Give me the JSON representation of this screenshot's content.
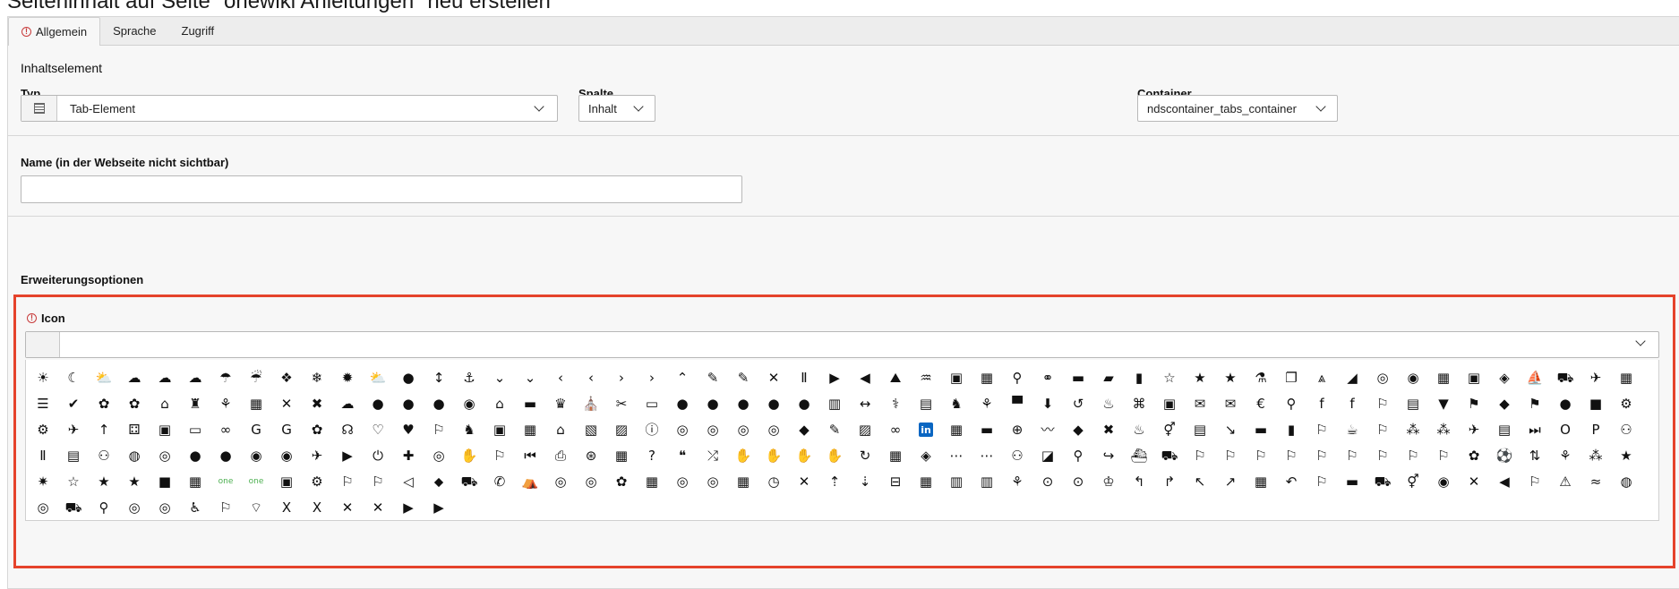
{
  "page": {
    "title": "Seiteninhalt auf Seite \"onewiki Anleitungen\" neu erstellen"
  },
  "tabs": [
    {
      "label": "Allgemein",
      "active": true,
      "has_warning": true
    },
    {
      "label": "Sprache"
    },
    {
      "label": "Zugriff"
    }
  ],
  "section_general": {
    "title": "Inhaltselement",
    "typ": {
      "label": "Typ",
      "value": "Tab-Element"
    },
    "spalte": {
      "label": "Spalte",
      "value": "Inhalt"
    },
    "container": {
      "label": "Container",
      "value": "ndscontainer_tabs_container"
    }
  },
  "name_field": {
    "label": "Name (in der Webseite nicht sichtbar)",
    "value": ""
  },
  "extensions": {
    "title": "Erweiterungsoptionen"
  },
  "icon_field": {
    "label": "Icon",
    "has_warning": true,
    "selected": "",
    "colors": {
      "highlight_border": "#e5432b",
      "warning": "#c83c3c"
    },
    "icons": [
      "☀",
      "☾",
      "⛅",
      "☁",
      "☁",
      "☁",
      "☂",
      "☔",
      "❖",
      "❄",
      "✹",
      "⛅",
      "●",
      "↕",
      "⚓",
      "⌄",
      "⌄",
      "‹",
      "‹",
      "›",
      "›",
      "⌃",
      "✎",
      "✎",
      "✕",
      "Ⅱ",
      "▶",
      "◀",
      "⛰",
      "♒",
      "▣",
      "▦",
      "⚲",
      "⚭",
      "▬",
      "▰",
      "▮",
      "☆",
      "★",
      "★",
      "⚗",
      "❐",
      "⩓",
      "◢",
      "◎",
      "◉",
      "▦",
      "▣",
      "◈",
      "⛵",
      "⛟",
      "✈",
      "▦",
      "☰",
      "✔",
      "✿",
      "✿",
      "⌂",
      "♜",
      "⚘",
      "▦",
      "✕",
      "✖",
      "☁",
      "●",
      "●",
      "●",
      "◉",
      "⌂",
      "▬",
      "♛",
      "⛪",
      "✂",
      "▭",
      "●",
      "●",
      "●",
      "●",
      "●",
      "▥",
      "↔",
      "⚕",
      "▤",
      "♞",
      "⚘",
      "▀",
      "⬇",
      "↺",
      "♨",
      "⌘",
      "▣",
      "✉",
      "✉",
      "€",
      "⚲",
      "f",
      "f",
      "⚐",
      "▤",
      "▼",
      "⚑",
      "◆",
      "⚑",
      "●",
      "■",
      "⚙",
      "⚙",
      "✈",
      "↑",
      "⚃",
      "▣",
      "▭",
      "∞",
      "G",
      "G",
      "✿",
      "☊",
      "♡",
      "♥",
      "⚐",
      "♞",
      "▣",
      "▦",
      "⌂",
      "▧",
      "▨",
      "ⓘ",
      "◎",
      "◎",
      "◎",
      "◎",
      "◆",
      "✎",
      "▨",
      "∞",
      "in",
      "▦",
      "▬",
      "⊕",
      "〰",
      "◆",
      "✖",
      "♨",
      "⚥",
      "▤",
      "↘",
      "▬",
      "▮",
      "⚐",
      "☕",
      "⚐",
      "⁂",
      "⁂",
      "✈",
      "▤",
      "⏭",
      "O",
      "P",
      "⚇",
      "Ⅱ",
      "▤",
      "⚇",
      "◍",
      "◎",
      "●",
      "●",
      "◉",
      "◉",
      "✈",
      "▶",
      "⏻",
      "✚",
      "◎",
      "✋",
      "⚐",
      "⏮",
      "⎙",
      "⊛",
      "▦",
      "?",
      "❝",
      "⤮",
      "✋",
      "✋",
      "✋",
      "✋",
      "↻",
      "▦",
      "◈",
      "⋯",
      "⋯",
      "⚇",
      "◪",
      "⚲",
      "↪",
      "⛴",
      "⛟",
      "⚐",
      "⚐",
      "⚐",
      "⚐",
      "⚐",
      "⚐",
      "⚐",
      "⚐",
      "⚐",
      "✿",
      "⚽",
      "⇅",
      "⚘",
      "⁂",
      "★",
      "✷",
      "☆",
      "★",
      "★",
      "■",
      "▦",
      "one",
      "one",
      "▣",
      "⚙",
      "⚐",
      "⚐",
      "◁",
      "⬥",
      "⛟",
      "✆",
      "⛺",
      "◎",
      "◎",
      "✿",
      "▦",
      "◎",
      "◎",
      "▦",
      "◷",
      "✕",
      "⇡",
      "⇣",
      "⊟",
      "▦",
      "▥",
      "▥",
      "⚘",
      "⊙",
      "⊙",
      "♔",
      "↰",
      "↱",
      "↖",
      "↗",
      "▦",
      "↶",
      "⚐",
      "▬",
      "⛟",
      "⚥",
      "◉",
      "✕",
      "◀",
      "⚐",
      "⚠",
      "≈",
      "◍",
      "◎",
      "⛟",
      "⚲",
      "◎",
      "◎",
      "♿",
      "⚐",
      "⌔",
      "X",
      "X",
      "✕",
      "✕",
      "▶",
      "▶"
    ]
  }
}
